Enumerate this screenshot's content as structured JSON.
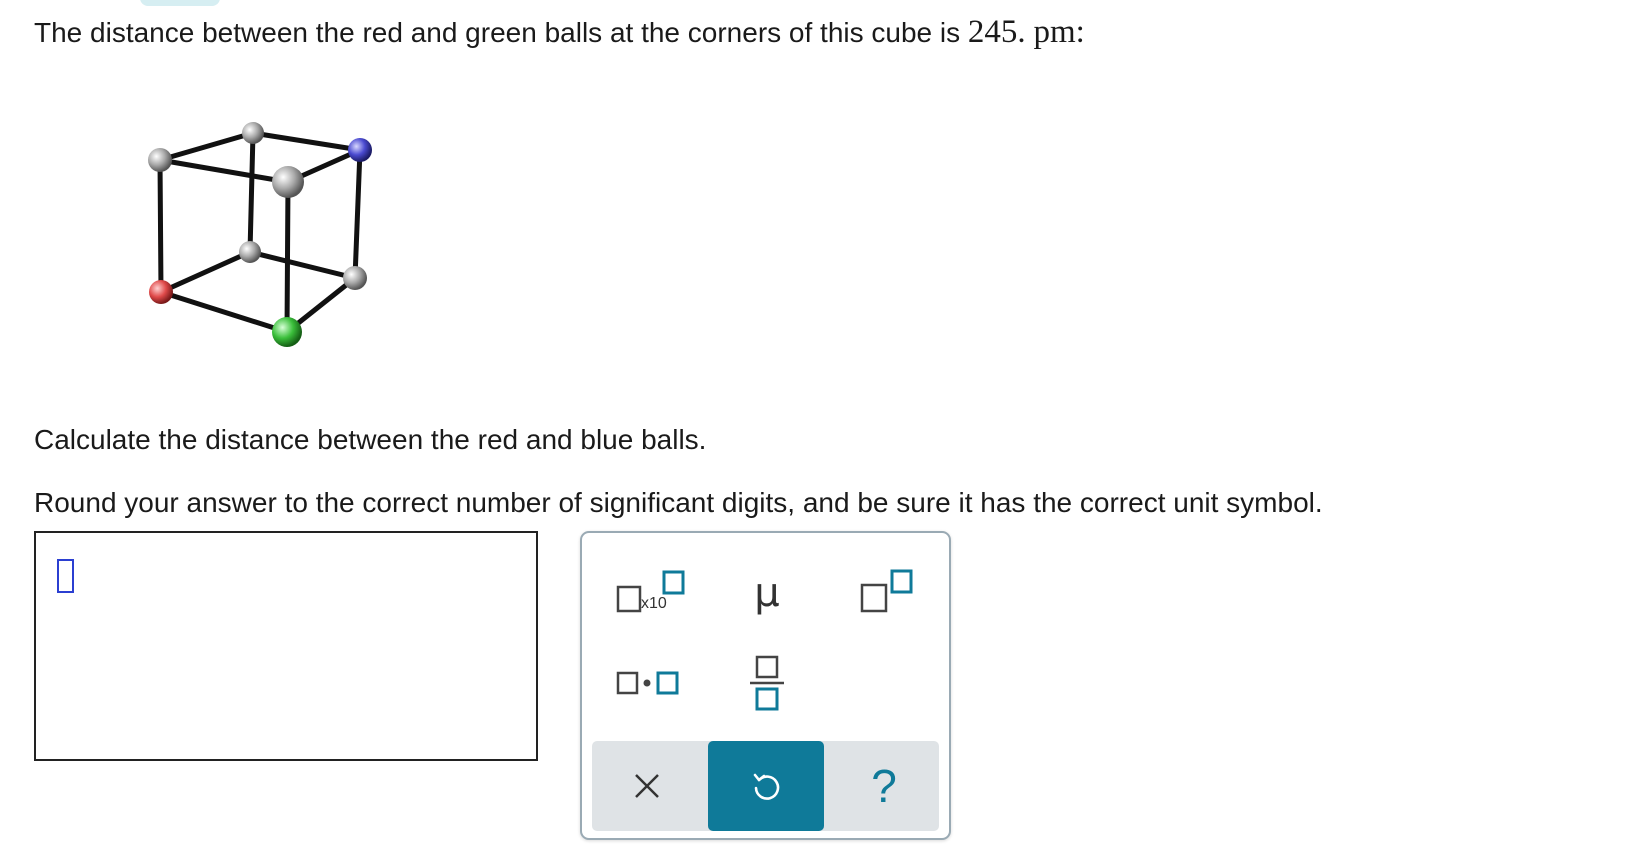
{
  "question": {
    "prefix": "The distance between the red and green balls at the corners of this cube is",
    "value": "245.",
    "unit": "pm",
    "colon": ":"
  },
  "instruction_calc": "Calculate the distance between the red and blue balls.",
  "instruction_round": "Round your answer to the correct number of significant digits, and be sure it has the correct unit symbol.",
  "answer": {
    "value": ""
  },
  "palette": {
    "sci_notation_label": "x10",
    "mu_symbol": "μ",
    "accent_color": "#0f7a99",
    "icons": [
      "x10-button-icon",
      "mu-icon",
      "superscript-icon",
      "multiply-dot-icon",
      "fraction-icon",
      "close-icon",
      "undo-icon",
      "help-icon"
    ]
  },
  "colors": {
    "red_ball": "#e04a4a",
    "green_ball": "#3bbf3b",
    "blue_ball": "#4a4ad0",
    "gray_ball": "#a9a9a9"
  }
}
